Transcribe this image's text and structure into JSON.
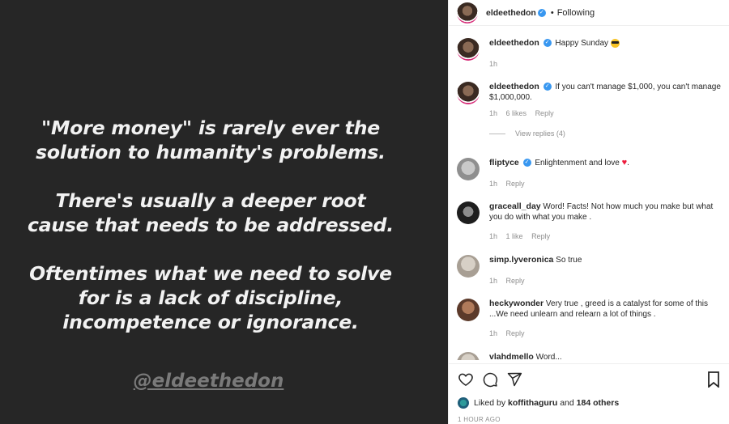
{
  "post": {
    "quote_paragraphs": [
      [
        "\"More money\" is rarely ever the",
        "solution to humanity's problems."
      ],
      [
        "There's usually a deeper root",
        "cause that needs to be addressed."
      ],
      [
        "Oftentimes what we need to solve",
        "for is a lack of discipline,",
        "incompetence or ignorance."
      ]
    ],
    "watermark": "@eldeethedon"
  },
  "header": {
    "username": "eldeethedon",
    "separator": "•",
    "follow_status": "Following"
  },
  "comments": [
    {
      "user": "eldeethedon",
      "verified": true,
      "text": "Happy Sunday",
      "time": "1h",
      "likes": "",
      "reply": ""
    },
    {
      "user": "eldeethedon",
      "verified": true,
      "text": "If you can't manage $1,000, you can't manage $1,000,000.",
      "time": "1h",
      "likes": "6 likes",
      "reply": "Reply",
      "view_replies": "View replies (4)"
    },
    {
      "user": "fliptyce",
      "verified": true,
      "text": "Enlightenment and love",
      "time": "1h",
      "likes": "",
      "reply": "Reply"
    },
    {
      "user": "graceall_day",
      "verified": false,
      "text": "Word! Facts! Not how much you make but what you do with what you make .",
      "time": "1h",
      "likes": "1 like",
      "reply": "Reply"
    },
    {
      "user": "simp.lyveronica",
      "verified": false,
      "text": "So true",
      "time": "1h",
      "likes": "",
      "reply": "Reply"
    },
    {
      "user": "heckywonder",
      "verified": false,
      "text": "Very true , greed is a catalyst for some of this ...We need unlearn and relearn a lot of things .",
      "time": "1h",
      "likes": "",
      "reply": "Reply"
    },
    {
      "user": "vlahdmello",
      "verified": false,
      "text": "Word...",
      "time": "",
      "likes": "",
      "reply": ""
    }
  ],
  "likes": {
    "prefix": "Liked by",
    "user": "koffithaguru",
    "joiner": "and",
    "others": "184 others"
  },
  "timestamp": "1 HOUR AGO",
  "colors": {
    "verified": "#3897f0",
    "heart": "#ed1c3c",
    "bg_dark": "#262626"
  }
}
